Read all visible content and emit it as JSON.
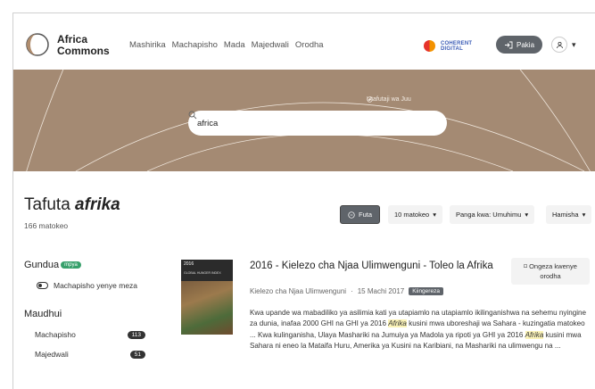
{
  "header": {
    "brand_line1": "Africa",
    "brand_line2": "Commons",
    "nav": [
      "Mashirika",
      "Machapisho",
      "Mada",
      "Majedwali",
      "Orodha"
    ],
    "partner_line1": "COHERENT",
    "partner_line2": "DIGITAL",
    "login_label": "Pakia",
    "user_caret": "▾"
  },
  "hero": {
    "advanced_label": "Utafutaji wa Juu",
    "search_value": "africa"
  },
  "results": {
    "title_prefix": "Tafuta ",
    "title_query": "afrika",
    "count": "166 matokeo",
    "clear_label": "Futa",
    "per_page": "10 matokeo",
    "sort": "Panga kwa: Umuhimu",
    "export": "Hamisha"
  },
  "facets": {
    "heading_format": "Gundua",
    "new_badge": "mpya",
    "toggle_label": "Machapisho yenye meza",
    "heading_content": "Maudhui",
    "items": [
      {
        "label": "Machapisho",
        "count": "113"
      },
      {
        "label": "Majedwali",
        "count": "51"
      }
    ]
  },
  "item": {
    "thumb_year": "2016",
    "thumb_title": "GLOBAL HUNGER INDEX",
    "title": "2016 - Kielezo cha Njaa Ulimwenguni - Toleo la Afrika",
    "bookmark_line1": "Ongeza kwenye",
    "bookmark_line2": "orodha",
    "source": "Kielezo cha Njaa Ulimwenguni",
    "date": "15 Machi 2017",
    "language": "Kiingereza",
    "excerpt_a": "Kwa upande wa mabadiliko ya asilimia kati ya utapiamlo na utapiamlo ikilinganishwa na sehemu nyingine za dunia, inafaa 2000 GHI na GHI ya 2016 ",
    "excerpt_hl1": "Afrika",
    "excerpt_b": " kusini mwa uboreshaji wa Sahara - kuzingatia matokeo ... Kwa kulinganisha, Ulaya Mashariki na Jumuiya ya Madola ya ripoti ya GHI ya 2016 ",
    "excerpt_hl2": "Afrika",
    "excerpt_c": " kusini mwa Sahara ni eneo la Mataifa Huru, Amerika ya Kusini na Karibiani, na Mashariki na ulimwengu na ..."
  },
  "colors": {
    "hero_bg": "#a48a73",
    "dark_button": "#5f646a",
    "new_badge": "#37a06b",
    "highlight": "#fbf3b8"
  }
}
